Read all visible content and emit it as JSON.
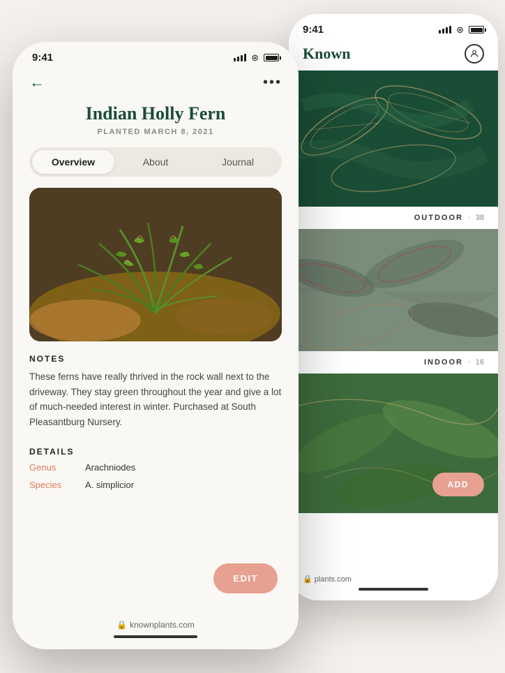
{
  "phone1": {
    "status": {
      "time": "9:41",
      "battery_level": "full"
    },
    "header": {
      "back_label": "←",
      "more_label": "•••"
    },
    "title": {
      "plant_name": "Indian Holly Fern",
      "plant_date": "PLANTED MARCH 8, 2021"
    },
    "tabs": [
      {
        "label": "Overview",
        "active": true
      },
      {
        "label": "About",
        "active": false
      },
      {
        "label": "Journal",
        "active": false
      }
    ],
    "notes": {
      "section_label": "NOTES",
      "text": "These ferns have really thrived in the rock wall next to the driveway. They stay green throughout the year and give a lot of much-needed interest in winter. Purchased at South Pleasantburg Nursery."
    },
    "details": {
      "section_label": "DETAILS",
      "rows": [
        {
          "label": "Genus",
          "value": "Arachniodes"
        },
        {
          "label": "Species",
          "value": "A. simplicior"
        }
      ]
    },
    "edit_button": "EDIT",
    "footer": {
      "url": "knownplants.com",
      "lock_icon": "🔒"
    }
  },
  "phone2": {
    "status": {
      "time": "9:41"
    },
    "header": {
      "app_name": "Known",
      "user_icon": "person"
    },
    "categories": [
      {
        "label": "OUTDOOR",
        "separator": "·",
        "count": "38"
      },
      {
        "label": "INDOOR",
        "separator": "·",
        "count": "16"
      }
    ],
    "add_button": "ADD",
    "footer": {
      "url": "plants.com",
      "lock_icon": "🔒"
    }
  }
}
